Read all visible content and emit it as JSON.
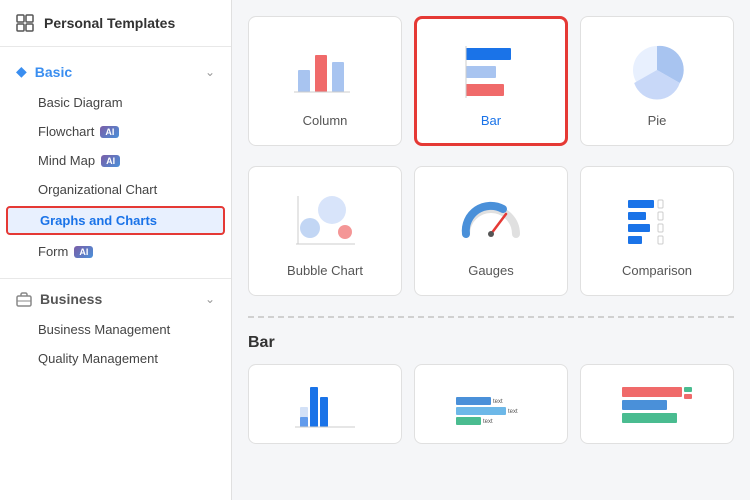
{
  "sidebar": {
    "header": {
      "title": "Personal Templates",
      "icon": "grid-icon"
    },
    "sections": [
      {
        "id": "basic",
        "title": "Basic",
        "icon": "diamond-icon",
        "color": "#3a8ef0",
        "expanded": true,
        "items": [
          {
            "id": "basic-diagram",
            "label": "Basic Diagram",
            "ai": false,
            "active": false
          },
          {
            "id": "flowchart",
            "label": "Flowchart",
            "ai": true,
            "active": false
          },
          {
            "id": "mind-map",
            "label": "Mind Map",
            "ai": true,
            "active": false
          },
          {
            "id": "org-chart",
            "label": "Organizational Chart",
            "ai": false,
            "active": false
          },
          {
            "id": "graphs-charts",
            "label": "Graphs and Charts",
            "ai": false,
            "active": true
          },
          {
            "id": "form",
            "label": "Form",
            "ai": true,
            "active": false
          }
        ]
      },
      {
        "id": "business",
        "title": "Business",
        "icon": "briefcase-icon",
        "expanded": true,
        "items": [
          {
            "id": "business-management",
            "label": "Business Management",
            "ai": false,
            "active": false
          },
          {
            "id": "quality-management",
            "label": "Quality Management",
            "ai": false,
            "active": false
          }
        ]
      }
    ]
  },
  "main": {
    "top_templates": [
      {
        "id": "column",
        "label": "Column"
      },
      {
        "id": "bar",
        "label": "Bar",
        "selected": true
      },
      {
        "id": "pie",
        "label": "Pie"
      }
    ],
    "bottom_templates": [
      {
        "id": "bubble-chart",
        "label": "Bubble Chart"
      },
      {
        "id": "gauges",
        "label": "Gauges"
      },
      {
        "id": "comparison",
        "label": "Comparison"
      }
    ],
    "section_label": "Bar",
    "bar_templates": [
      {
        "id": "bar-1"
      },
      {
        "id": "bar-2"
      },
      {
        "id": "bar-3"
      }
    ],
    "ai_badge_label": "AI"
  }
}
